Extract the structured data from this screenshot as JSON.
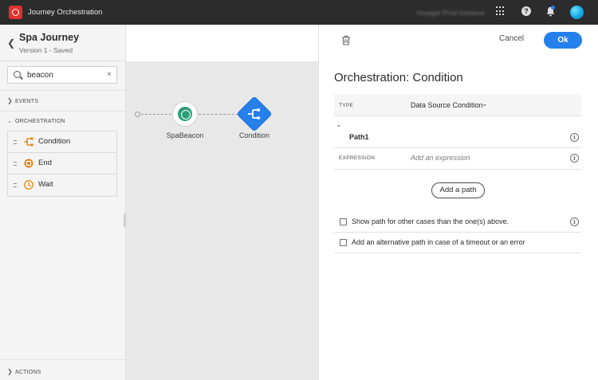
{
  "topbar": {
    "app_title": "Journey Orchestration",
    "instance_name": "Voyager Prod Instance",
    "icons": [
      "adobe-logo-icon",
      "app-switcher-icon",
      "help-icon",
      "notifications-bell-icon",
      "user-avatar"
    ]
  },
  "journey": {
    "name": "Spa Journey",
    "version": "Version 1 - Saved"
  },
  "search": {
    "value": "beacon",
    "clear_glyph": "×"
  },
  "sections": {
    "events": "EVENTS",
    "orchestration": "ORCHESTRATION",
    "actions": "ACTIONS"
  },
  "orchestration_items": [
    {
      "label": "Condition",
      "icon": "condition-icon"
    },
    {
      "label": "End",
      "icon": "end-icon"
    },
    {
      "label": "Wait",
      "icon": "wait-icon"
    }
  ],
  "canvas": {
    "nodes": [
      {
        "label": "SpaBeacon",
        "type": "event",
        "color": "#2d9d78"
      },
      {
        "label": "Condition",
        "type": "condition",
        "color": "#2680eb"
      }
    ]
  },
  "panel": {
    "cancel_label": "Cancel",
    "ok_label": "Ok",
    "title": "Orchestration: Condition",
    "type_label": "TYPE",
    "type_value": "Data Source Condition",
    "path_name": "Path1",
    "expression_label": "EXPRESSION",
    "expression_placeholder": "Add an expression",
    "add_path_label": "Add a path",
    "option_other_cases": "Show path for other cases than the one(s) above.",
    "option_timeout": "Add an alternative path in case of a timeout or an error",
    "info_glyph": "i"
  },
  "colors": {
    "accent": "#2680eb",
    "event_node": "#2d9d78",
    "orchestration_icon": "#e68619",
    "topbar": "#2c2c2c",
    "logo": "#e0332c"
  }
}
